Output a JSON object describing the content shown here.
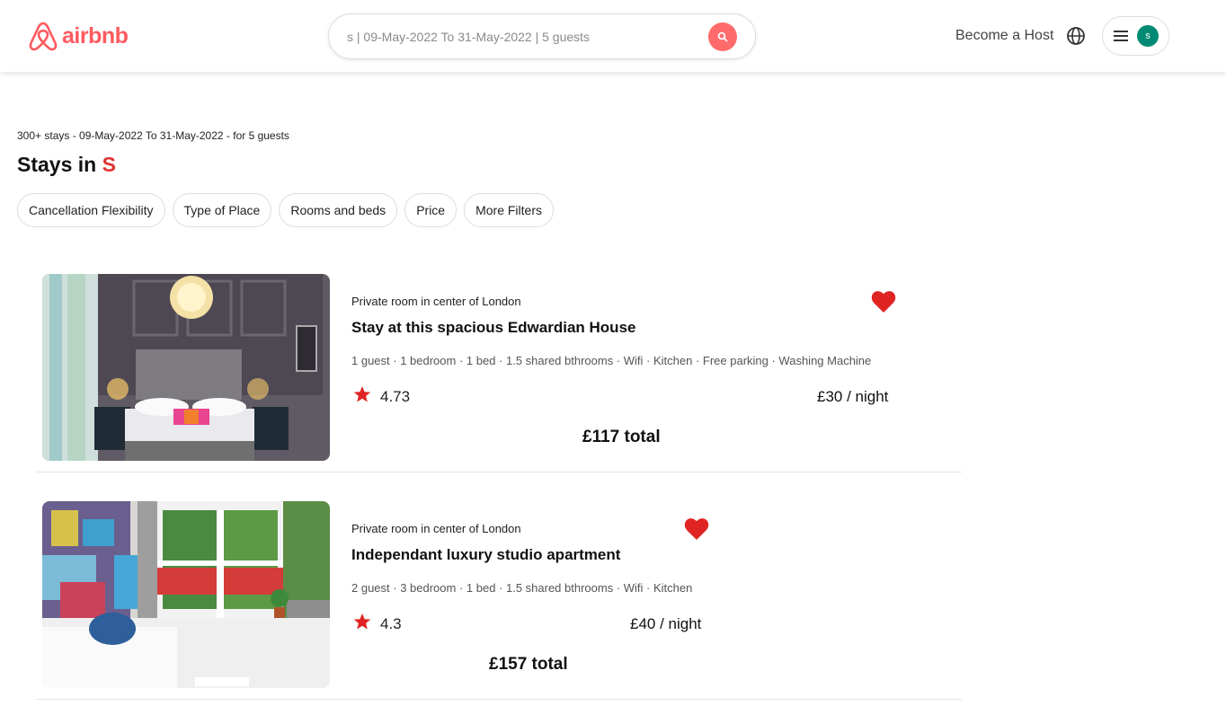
{
  "brand": {
    "name": "airbnb",
    "color": "#ff5a5f"
  },
  "search": {
    "value": "s | 09-May-2022 To 31-May-2022 | 5 guests",
    "button_icon": "search-icon"
  },
  "header": {
    "host_label": "Become a Host",
    "globe_icon": "globe-icon",
    "menu_icon": "hamburger-icon",
    "avatar_initial": "s"
  },
  "results": {
    "summary": "300+ stays - 09-May-2022 To 31-May-2022 - for 5 guests",
    "title_prefix": "Stays in",
    "title_location": "S"
  },
  "filters": [
    "Cancellation Flexibility",
    "Type of Place",
    "Rooms and beds",
    "Price",
    "More Filters"
  ],
  "listings": [
    {
      "type": "Private room in center of London",
      "title": "Stay at this spacious Edwardian House",
      "amenities": "1 guest · 1 bedroom · 1 bed · 1.5 shared bthrooms · Wifi · Kitchen · Free parking · Washing Machine",
      "rating": "4.73",
      "price": "£30 / night",
      "total": "£117 total",
      "favorited": true
    },
    {
      "type": "Private room in center of London",
      "title": "Independant luxury studio apartment",
      "amenities": "2 guest · 3 bedroom · 1 bed · 1.5 shared bthrooms · Wifi · Kitchen",
      "rating": "4.3",
      "price": "£40 / night",
      "total": "£157 total",
      "favorited": true
    }
  ],
  "colors": {
    "accent": "#ff5a5f",
    "heart": "#e02424",
    "star": "#e02424",
    "avatar": "#008a73"
  }
}
